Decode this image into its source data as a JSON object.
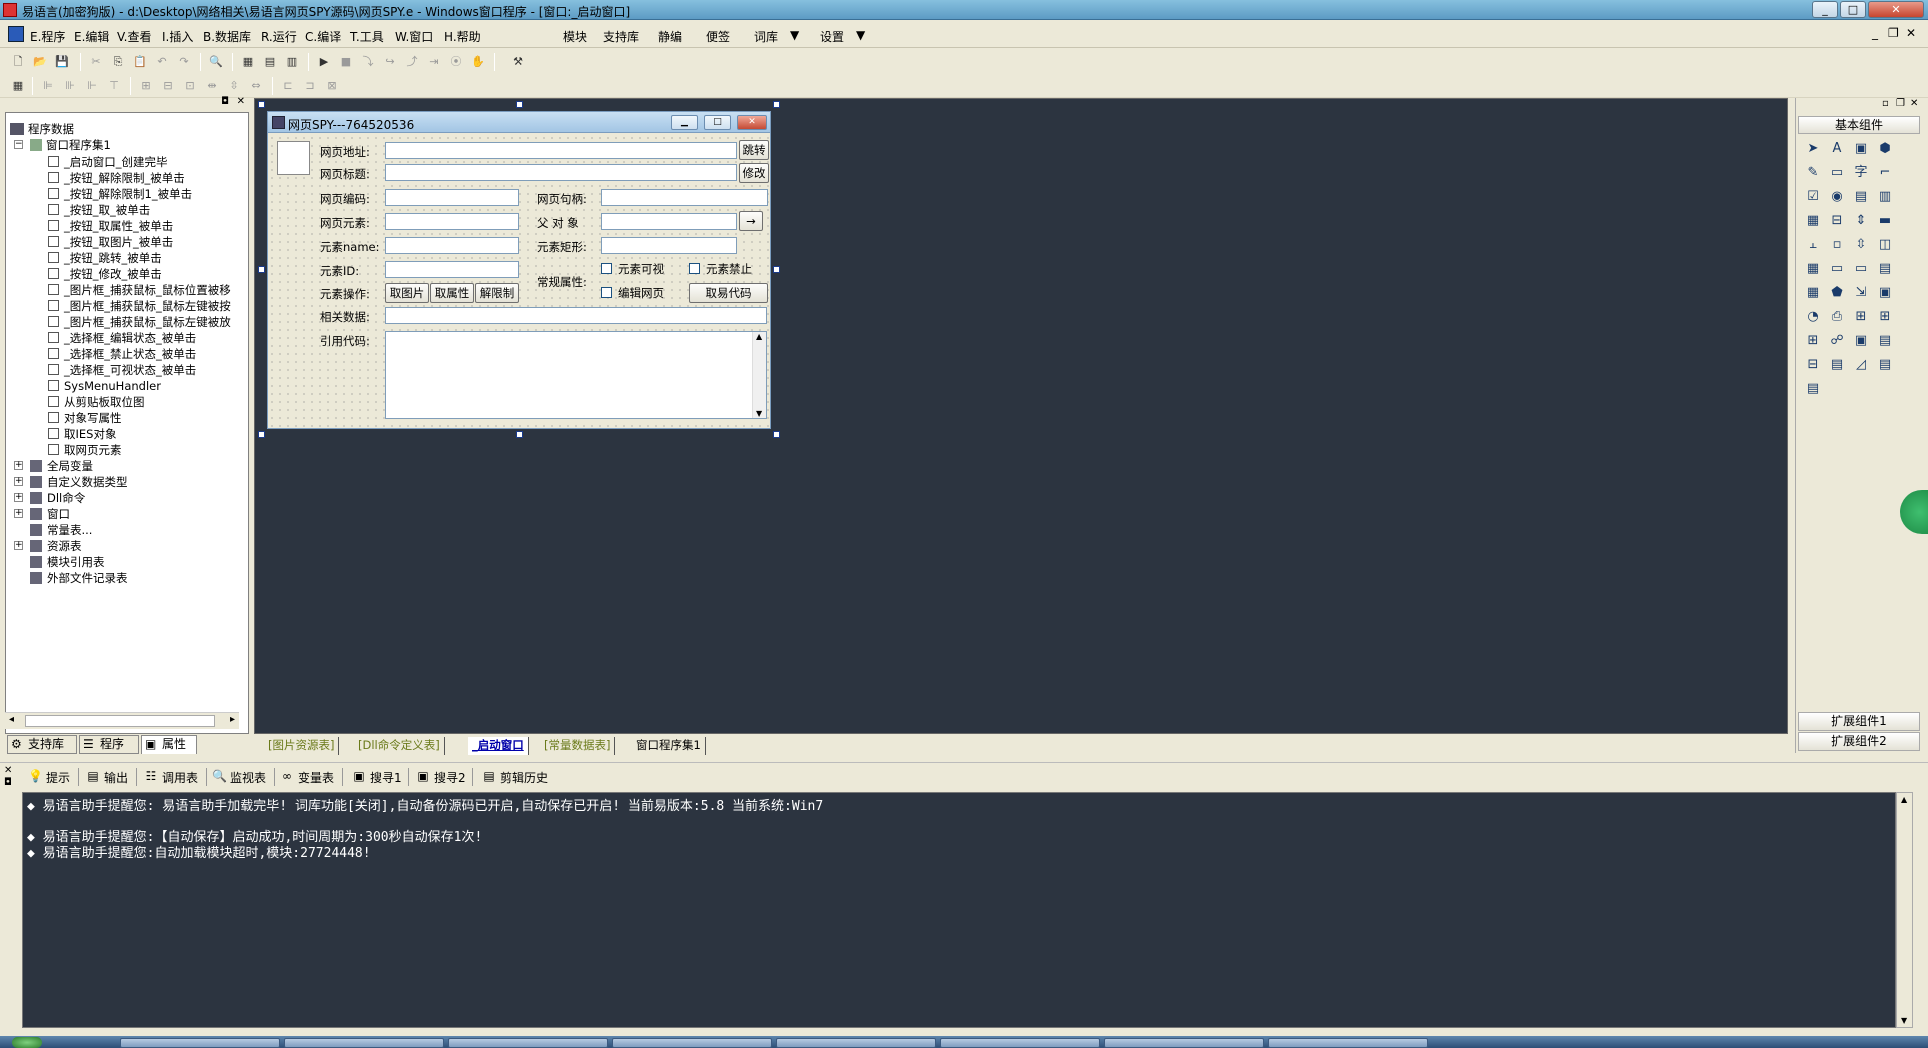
{
  "window": {
    "title": "易语言(加密狗版) - d:\\Desktop\\网络相关\\易语言网页SPY源码\\网页SPY.e - Windows窗口程序 - [窗口:_启动窗口]"
  },
  "menu": [
    "E.程序",
    "E.编辑",
    "V.查看",
    "I.插入",
    "B.数据库",
    "R.运行",
    "C.编译",
    "T.工具",
    "W.窗口",
    "H.帮助"
  ],
  "menu_right": [
    "模块",
    "支持库",
    "静编",
    "便签",
    "词库",
    "设置"
  ],
  "tree": {
    "root": "程序数据",
    "group": "窗口程序集1",
    "children": [
      "_启动窗口_创建完毕",
      "_按钮_解除限制_被单击",
      "_按钮_解除限制1_被单击",
      "_按钮_取_被单击",
      "_按钮_取属性_被单击",
      "_按钮_取图片_被单击",
      "_按钮_跳转_被单击",
      "_按钮_修改_被单击",
      "_图片框_捕获鼠标_鼠标位置被移",
      "_图片框_捕获鼠标_鼠标左键被按",
      "_图片框_捕获鼠标_鼠标左键被放",
      "_选择框_编辑状态_被单击",
      "_选择框_禁止状态_被单击",
      "_选择框_可视状态_被单击",
      "SysMenuHandler",
      "从剪贴板取位图",
      "对象写属性",
      "取IES对象",
      "取网页元素"
    ],
    "top_nodes": [
      "全局变量",
      "自定义数据类型",
      "Dll命令",
      "窗口",
      "常量表...",
      "资源表",
      "模块引用表",
      "外部文件记录表"
    ]
  },
  "left_tabs": [
    "支持库",
    "程序",
    "属性"
  ],
  "form": {
    "title": "网页SPY---764520536",
    "labels": {
      "url": "网页地址:",
      "title": "网页标题:",
      "encoding": "网页编码:",
      "handle": "网页句柄:",
      "element": "网页元素:",
      "parent": "父 对 象",
      "elname": "元素name:",
      "rect": "元素矩形:",
      "elid": "元素ID:",
      "common": "常规属性:",
      "ops": "元素操作:",
      "related": "相关数据:",
      "code": "引用代码:"
    },
    "buttons": {
      "jump": "跳转",
      "modify": "修改",
      "arrow": "→",
      "getimg": "取图片",
      "getattr": "取属性",
      "unlock": "解限制",
      "getcode": "取易代码"
    },
    "checks": {
      "visible": "元素可视",
      "disabled": "元素禁止",
      "editpage": "编辑网页"
    }
  },
  "design_tabs": [
    "[图片资源表]",
    "[Dll命令定义表]",
    "_启动窗口",
    "[常量数据表]",
    "窗口程序集1"
  ],
  "palette": {
    "title": "基本组件",
    "ext1": "扩展组件1",
    "ext2": "扩展组件2"
  },
  "output_tabs": [
    "提示",
    "输出",
    "调用表",
    "监视表",
    "变量表",
    "搜寻1",
    "搜寻2",
    "剪辑历史"
  ],
  "output_lines": [
    "◆ 易语言助手提醒您:  易语言助手加载完毕!  词库功能[关闭],自动备份源码已开启,自动保存已开启!  当前易版本:5.8  当前系统:Win7",
    "◆ 易语言助手提醒您:【自动保存】启动成功,时间周期为:300秒自动保存1次!",
    "◆ 易语言助手提醒您:自动加载模块超时,模块:27724448!"
  ]
}
